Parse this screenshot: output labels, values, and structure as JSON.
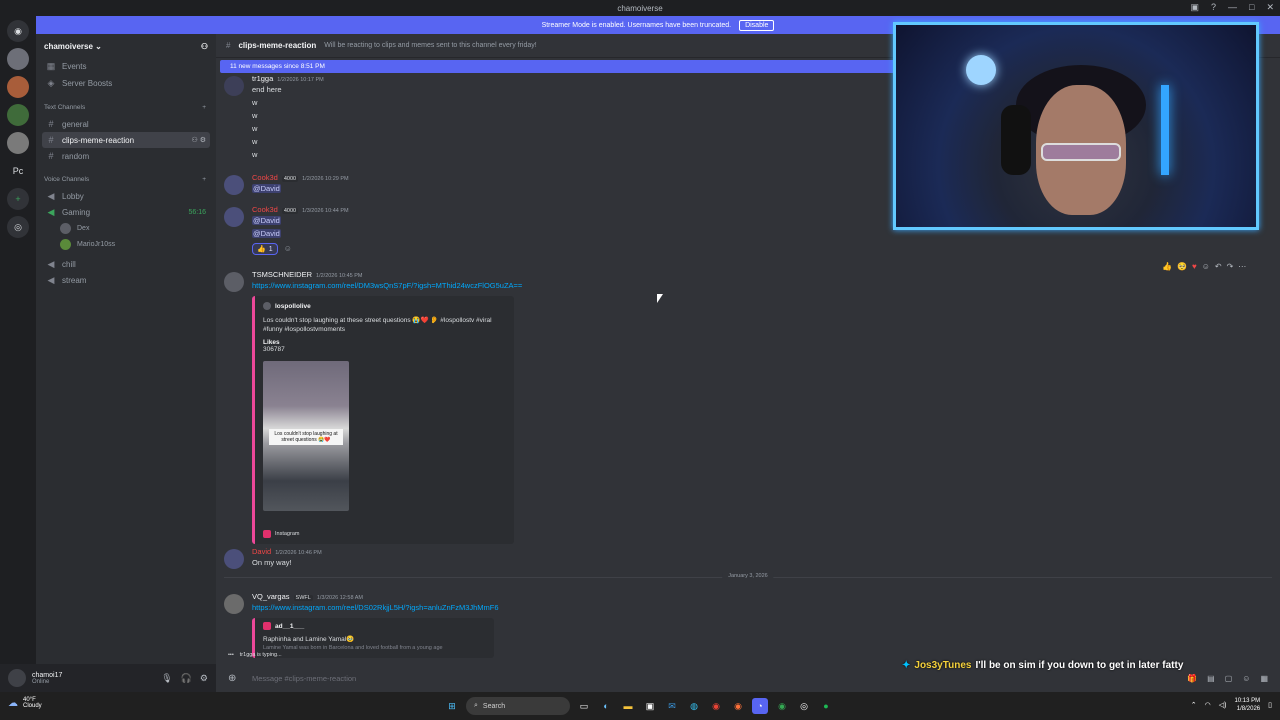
{
  "window": {
    "title": "chamoiverse"
  },
  "banner": {
    "text": "Streamer Mode is enabled. Usernames have been truncated.",
    "button": "Disable"
  },
  "guilds": {
    "pc_label": "Pc"
  },
  "sidebar": {
    "server_name": "chamoiverse",
    "top_items": [
      {
        "icon": "calendar-icon",
        "label": "Events"
      },
      {
        "icon": "boost-icon",
        "label": "Server Boosts"
      }
    ],
    "text_category": "Text Channels",
    "text_channels": [
      "general",
      "clips-meme-reaction",
      "random"
    ],
    "voice_category": "Voice Channels",
    "voice_channels": [
      {
        "label": "Lobby",
        "extra": ""
      },
      {
        "label": "Gaming",
        "extra": "56:16"
      }
    ],
    "voice_users": [
      "Dex",
      "MarioJr10ss"
    ],
    "voice_channels_after": [
      "chill",
      "stream"
    ]
  },
  "user_panel": {
    "name": "chamoi17",
    "status": "Online"
  },
  "header": {
    "channel": "clips-meme-reaction",
    "topic": "Will be reacting to clips and memes sent to this channel every friday!"
  },
  "new_messages_bar": "11 new messages since 8:51 PM",
  "messages": {
    "m1": {
      "user": "tr1gga",
      "ts": "1/2/2026 10:17 PM",
      "lines": [
        "end here",
        "w",
        "w",
        "w",
        "w",
        "w"
      ]
    },
    "m2": {
      "user": "Cook3d",
      "badge": "4000",
      "ts": "1/2/2026 10:29 PM",
      "mention": "@David"
    },
    "m3": {
      "user": "Cook3d",
      "badge": "4000",
      "ts": "1/3/2026 10:44 PM",
      "mention1": "@David",
      "mention2": "@David",
      "reaction_emoji": "👍",
      "reaction_count": "1"
    },
    "m4": {
      "user": "TSMSCHNEIDER",
      "ts": "1/2/2026 10:45 PM",
      "link": "https://www.instagram.com/reel/DM3wsQnS7pF/?igsh=MThid24wczFlOG5uZA==",
      "embed_author": "lospollolive",
      "embed_desc": "Los couldn't stop laughing at these street questions 😭❤️ 👂 #lospollostv #viral #funny #lospollostvmoments",
      "embed_field_name": "Likes",
      "embed_field_value": "306787",
      "thumb_caption": "Los couldn't stop laughing at street questions 😭❤️",
      "footer": "Instagram"
    },
    "m5": {
      "user": "David",
      "ts": "1/2/2026 10:46 PM",
      "text": "On my way!"
    },
    "date_divider": "January 3, 2026",
    "m6": {
      "user": "VQ_vargas",
      "badge": "SWFL",
      "ts": "1/3/2026 12:58 AM",
      "link": "https://www.instagram.com/reel/DS02RkjjL5H/?igsh=anluZnFzM3JhMmF6",
      "embed_author": "ad__1___",
      "embed_desc": "Raphinha and Lamine Yamal🥹",
      "embed_desc2": "Lamine Yamal was born in Barcelona and loved football from a young age"
    }
  },
  "typing": "tr1gga is typing...",
  "composer": {
    "placeholder": "Message #clips-meme-reaction"
  },
  "ticker": {
    "user": "Jos3yTunes",
    "text": "I'll be on sim if you down to get in later fatty"
  },
  "taskbar": {
    "weather_temp": "40°F",
    "weather_desc": "Cloudy",
    "search": "Search",
    "time": "10:13 PM",
    "date": "1/8/2026"
  },
  "colors": {
    "accent": "#5865f2",
    "bg": "#313338",
    "sidebar": "#2b2d31",
    "webcam_border": "#62c9ff",
    "ticker_name": "#f5d13b"
  }
}
